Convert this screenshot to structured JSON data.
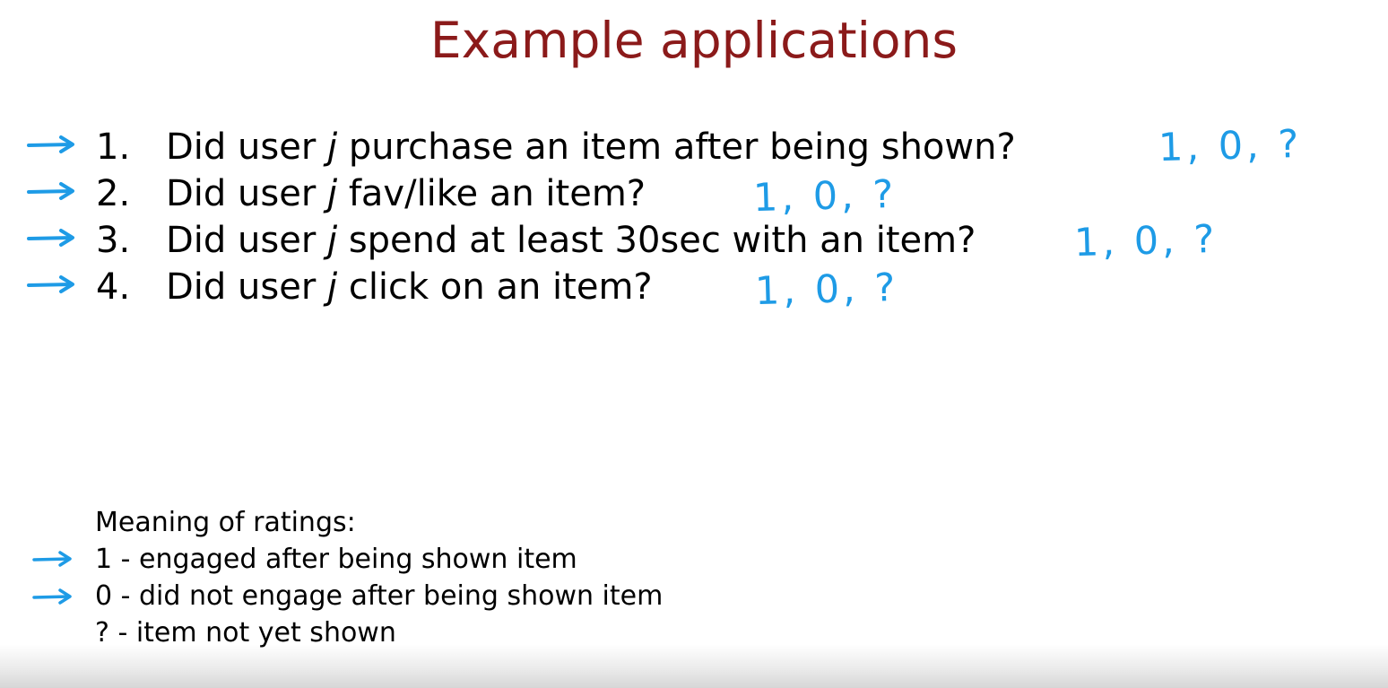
{
  "title": "Example applications",
  "questions": [
    {
      "number": "1.",
      "before": "Did user ",
      "var": "j",
      "after": " purchase an item after being shown?",
      "handwritten": "1, 0, ?"
    },
    {
      "number": "2.",
      "before": "Did user ",
      "var": "j",
      "after": " fav/like an item?",
      "handwritten": "1, 0, ?"
    },
    {
      "number": "3.",
      "before": "Did user ",
      "var": "j",
      "after": " spend at least 30sec with an item?",
      "handwritten": "1, 0, ?"
    },
    {
      "number": "4.",
      "before": "Did user ",
      "var": "j",
      "after": " click on an item?",
      "handwritten": "1, 0, ?"
    }
  ],
  "meaning": {
    "heading": "Meaning of ratings:",
    "items": [
      "1 - engaged after being shown item",
      "0 - did not engage after being shown item",
      "? - item not yet shown"
    ]
  },
  "colors": {
    "title": "#8b1a1a",
    "annotation": "#1e9be6",
    "text": "#000000"
  },
  "icons": {
    "question_marker": "arrow-right-icon",
    "meaning_marker": "arrow-right-icon"
  }
}
